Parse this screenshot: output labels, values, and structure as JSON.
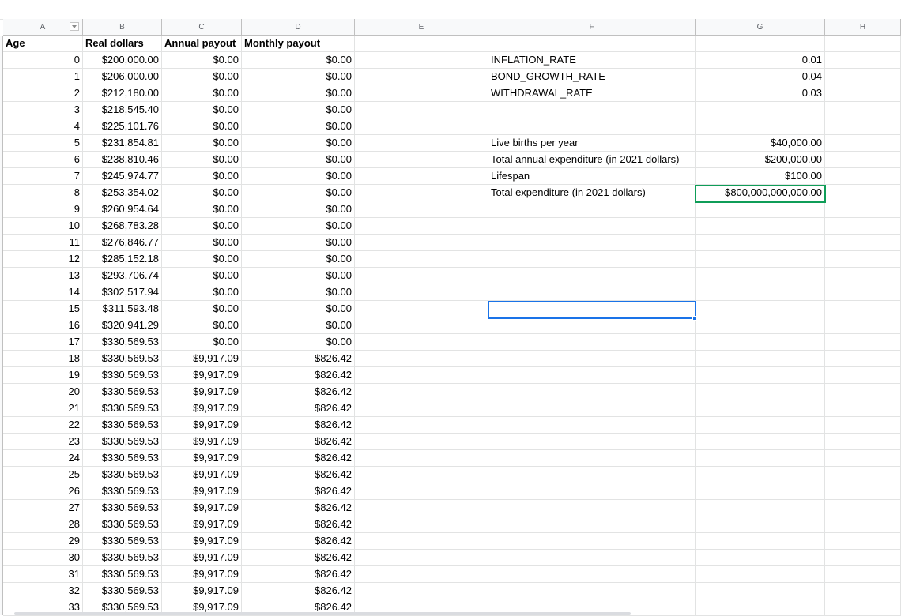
{
  "columns": [
    {
      "letter": "A"
    },
    {
      "letter": "B"
    },
    {
      "letter": "C"
    },
    {
      "letter": "D"
    },
    {
      "letter": "E"
    },
    {
      "letter": "F"
    },
    {
      "letter": "G"
    },
    {
      "letter": "H"
    }
  ],
  "header_row": {
    "age": "Age",
    "real_dollars": "Real dollars",
    "annual_payout": "Annual payout",
    "monthly_payout": "Monthly payout"
  },
  "rows": [
    {
      "age": "0",
      "real": "$200,000.00",
      "annual": "$0.00",
      "monthly": "$0.00",
      "label": "INFLATION_RATE",
      "value": "0.01"
    },
    {
      "age": "1",
      "real": "$206,000.00",
      "annual": "$0.00",
      "monthly": "$0.00",
      "label": "BOND_GROWTH_RATE",
      "value": "0.04"
    },
    {
      "age": "2",
      "real": "$212,180.00",
      "annual": "$0.00",
      "monthly": "$0.00",
      "label": "WITHDRAWAL_RATE",
      "value": "0.03"
    },
    {
      "age": "3",
      "real": "$218,545.40",
      "annual": "$0.00",
      "monthly": "$0.00",
      "label": "",
      "value": ""
    },
    {
      "age": "4",
      "real": "$225,101.76",
      "annual": "$0.00",
      "monthly": "$0.00",
      "label": "",
      "value": ""
    },
    {
      "age": "5",
      "real": "$231,854.81",
      "annual": "$0.00",
      "monthly": "$0.00",
      "label": "Live births per year",
      "value": "$40,000.00"
    },
    {
      "age": "6",
      "real": "$238,810.46",
      "annual": "$0.00",
      "monthly": "$0.00",
      "label": "Total annual expenditure (in 2021 dollars)",
      "value": "$200,000.00"
    },
    {
      "age": "7",
      "real": "$245,974.77",
      "annual": "$0.00",
      "monthly": "$0.00",
      "label": "Lifespan",
      "value": "$100.00"
    },
    {
      "age": "8",
      "real": "$253,354.02",
      "annual": "$0.00",
      "monthly": "$0.00",
      "label": "Total expenditure (in 2021 dollars)",
      "value": "$800,000,000,000.00"
    },
    {
      "age": "9",
      "real": "$260,954.64",
      "annual": "$0.00",
      "monthly": "$0.00",
      "label": "",
      "value": ""
    },
    {
      "age": "10",
      "real": "$268,783.28",
      "annual": "$0.00",
      "monthly": "$0.00",
      "label": "",
      "value": ""
    },
    {
      "age": "11",
      "real": "$276,846.77",
      "annual": "$0.00",
      "monthly": "$0.00",
      "label": "",
      "value": ""
    },
    {
      "age": "12",
      "real": "$285,152.18",
      "annual": "$0.00",
      "monthly": "$0.00",
      "label": "",
      "value": ""
    },
    {
      "age": "13",
      "real": "$293,706.74",
      "annual": "$0.00",
      "monthly": "$0.00",
      "label": "",
      "value": ""
    },
    {
      "age": "14",
      "real": "$302,517.94",
      "annual": "$0.00",
      "monthly": "$0.00",
      "label": "",
      "value": ""
    },
    {
      "age": "15",
      "real": "$311,593.48",
      "annual": "$0.00",
      "monthly": "$0.00",
      "label": "",
      "value": ""
    },
    {
      "age": "16",
      "real": "$320,941.29",
      "annual": "$0.00",
      "monthly": "$0.00",
      "label": "",
      "value": ""
    },
    {
      "age": "17",
      "real": "$330,569.53",
      "annual": "$0.00",
      "monthly": "$0.00",
      "label": "",
      "value": ""
    },
    {
      "age": "18",
      "real": "$330,569.53",
      "annual": "$9,917.09",
      "monthly": "$826.42",
      "label": "",
      "value": ""
    },
    {
      "age": "19",
      "real": "$330,569.53",
      "annual": "$9,917.09",
      "monthly": "$826.42",
      "label": "",
      "value": ""
    },
    {
      "age": "20",
      "real": "$330,569.53",
      "annual": "$9,917.09",
      "monthly": "$826.42",
      "label": "",
      "value": ""
    },
    {
      "age": "21",
      "real": "$330,569.53",
      "annual": "$9,917.09",
      "monthly": "$826.42",
      "label": "",
      "value": ""
    },
    {
      "age": "22",
      "real": "$330,569.53",
      "annual": "$9,917.09",
      "monthly": "$826.42",
      "label": "",
      "value": ""
    },
    {
      "age": "23",
      "real": "$330,569.53",
      "annual": "$9,917.09",
      "monthly": "$826.42",
      "label": "",
      "value": ""
    },
    {
      "age": "24",
      "real": "$330,569.53",
      "annual": "$9,917.09",
      "monthly": "$826.42",
      "label": "",
      "value": ""
    },
    {
      "age": "25",
      "real": "$330,569.53",
      "annual": "$9,917.09",
      "monthly": "$826.42",
      "label": "",
      "value": ""
    },
    {
      "age": "26",
      "real": "$330,569.53",
      "annual": "$9,917.09",
      "monthly": "$826.42",
      "label": "",
      "value": ""
    },
    {
      "age": "27",
      "real": "$330,569.53",
      "annual": "$9,917.09",
      "monthly": "$826.42",
      "label": "",
      "value": ""
    },
    {
      "age": "28",
      "real": "$330,569.53",
      "annual": "$9,917.09",
      "monthly": "$826.42",
      "label": "",
      "value": ""
    },
    {
      "age": "29",
      "real": "$330,569.53",
      "annual": "$9,917.09",
      "monthly": "$826.42",
      "label": "",
      "value": ""
    },
    {
      "age": "30",
      "real": "$330,569.53",
      "annual": "$9,917.09",
      "monthly": "$826.42",
      "label": "",
      "value": ""
    },
    {
      "age": "31",
      "real": "$330,569.53",
      "annual": "$9,917.09",
      "monthly": "$826.42",
      "label": "",
      "value": ""
    },
    {
      "age": "32",
      "real": "$330,569.53",
      "annual": "$9,917.09",
      "monthly": "$826.42",
      "label": "",
      "value": ""
    },
    {
      "age": "33",
      "real": "$330,569.53",
      "annual": "$9,917.09",
      "monthly": "$826.42",
      "label": "",
      "value": ""
    }
  ],
  "colors": {
    "header_bg": "#f8f9fa",
    "gridline": "#e2e3e3",
    "selection_green": "#0f9d58",
    "selection_blue": "#1a73e8"
  },
  "icons": {
    "filter": "filter-dropdown-icon"
  }
}
